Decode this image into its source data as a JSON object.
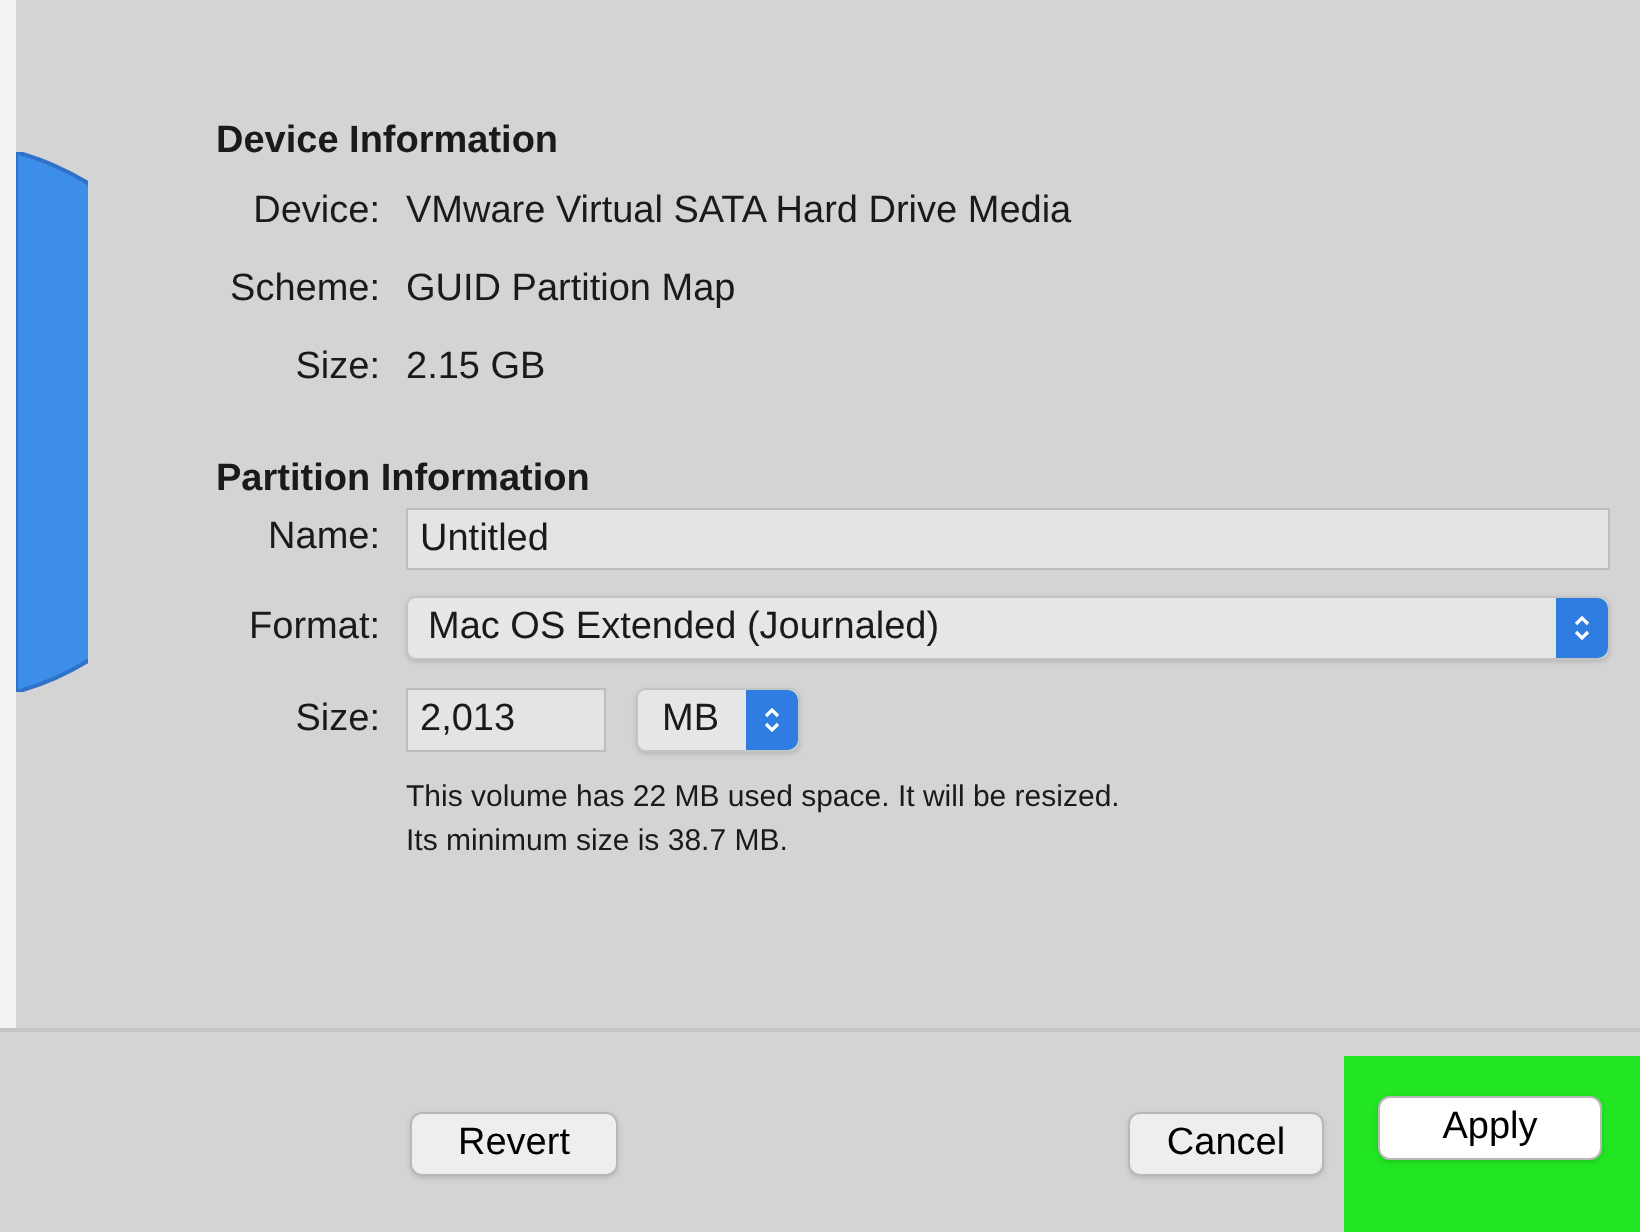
{
  "device_information": {
    "title": "Device Information",
    "rows": [
      {
        "label": "Device:",
        "value": "VMware Virtual SATA Hard Drive Media"
      },
      {
        "label": "Scheme:",
        "value": "GUID Partition Map"
      },
      {
        "label": "Size:",
        "value": "2.15 GB"
      }
    ]
  },
  "partition_information": {
    "title": "Partition Information",
    "name": {
      "label": "Name:",
      "value": "Untitled"
    },
    "format": {
      "label": "Format:",
      "value": "Mac OS Extended (Journaled)"
    },
    "size": {
      "label": "Size:",
      "value": "2,013",
      "unit": "MB"
    },
    "note": [
      "This volume has 22 MB used space. It will be resized.",
      "Its minimum size is 38.7 MB."
    ]
  },
  "buttons": [
    {
      "label": "Revert",
      "highlighted": false
    },
    {
      "label": "Cancel",
      "highlighted": false
    },
    {
      "label": "Apply",
      "highlighted": true
    }
  ]
}
